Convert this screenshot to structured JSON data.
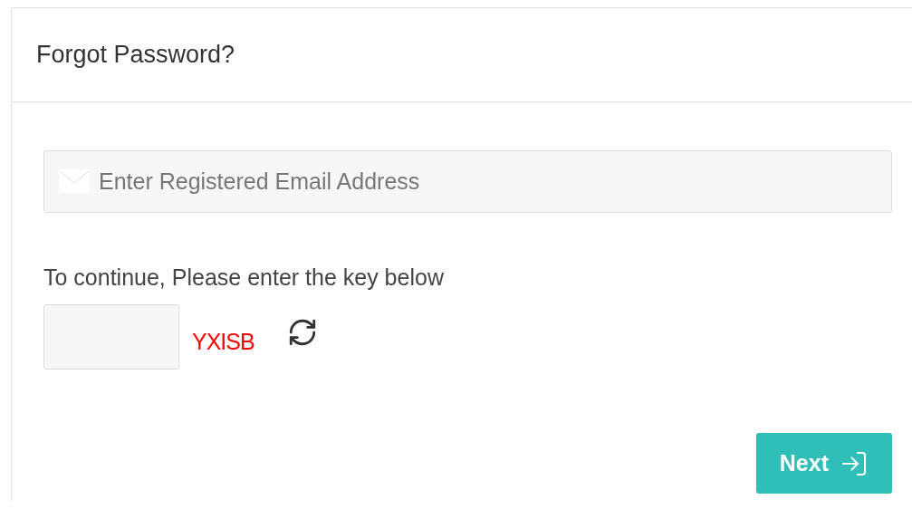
{
  "dialog": {
    "title": "Forgot Password?"
  },
  "email_field": {
    "placeholder": "Enter Registered Email Address"
  },
  "captcha": {
    "prompt": "To continue, Please enter the key below",
    "key": "YXISB"
  },
  "next_button": {
    "label": "Next"
  }
}
